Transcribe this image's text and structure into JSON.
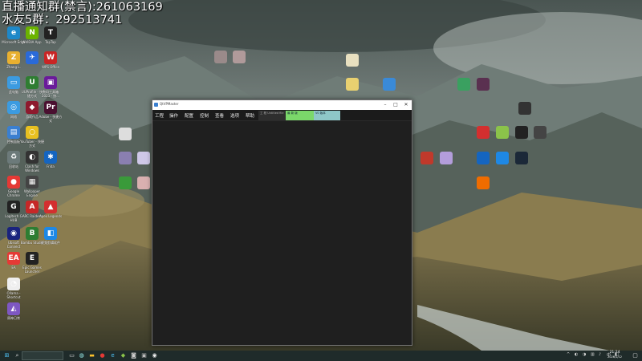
{
  "overlay": {
    "line1": "直播通知群(禁言):261063169",
    "line2": "水友5群：292513741"
  },
  "desktop_icons": [
    {
      "id": "edge",
      "label": "Microsoft Edge",
      "color": "#1e88c8",
      "glyph": "e"
    },
    {
      "id": "nvidia",
      "label": "NVIDIA App",
      "color": "#6bb300",
      "glyph": "N"
    },
    {
      "id": "taptap",
      "label": "TapTap",
      "color": "#222",
      "glyph": "T"
    },
    {
      "id": "zhang",
      "label": "Zhang L.",
      "color": "#e8b030",
      "glyph": "Z"
    },
    {
      "id": "app-blue",
      "label": "",
      "color": "#2a6ad8",
      "glyph": "✈"
    },
    {
      "id": "wps",
      "label": "WPS Office",
      "color": "#c92525",
      "glyph": "W"
    },
    {
      "id": "pc",
      "label": "此电脑",
      "color": "#3c9be0",
      "glyph": "▭"
    },
    {
      "id": "uuprofile",
      "label": "UUProfile - 快捷方式",
      "color": "#2f7d32",
      "glyph": "U"
    },
    {
      "id": "shouji",
      "label": "数码工具箱 2023 - 快...",
      "color": "#6a1b9a",
      "glyph": "▣"
    },
    {
      "id": "net",
      "label": "网络",
      "color": "#3c9be0",
      "glyph": "◎"
    },
    {
      "id": "game",
      "label": "游戏作品",
      "color": "#8e1a2e",
      "glyph": "◆"
    },
    {
      "id": "adobe",
      "label": "Adobe - 快捷方式",
      "color": "#4a1030",
      "glyph": "Pr"
    },
    {
      "id": "panel",
      "label": "控制面板",
      "color": "#3a7fd0",
      "glyph": "▤"
    },
    {
      "id": "shell",
      "label": "YouTuber - 快捷方式",
      "color": "#e8c020",
      "glyph": "○"
    },
    {
      "id": "recycle",
      "label": "回收站",
      "color": "#6c7a7a",
      "glyph": "♻"
    },
    {
      "id": "clash",
      "label": "Clash for Windows",
      "color": "#333",
      "glyph": "◐"
    },
    {
      "id": "frida",
      "label": "Frida",
      "color": "#1565c0",
      "glyph": "✱"
    },
    {
      "id": "chrome",
      "label": "Google Chrome",
      "color": "#e53935",
      "glyph": "●"
    },
    {
      "id": "wallpaper",
      "label": "Wallpaper Engine",
      "color": "#444",
      "glyph": "▦"
    },
    {
      "id": "logi",
      "label": "Logitech G HUB",
      "color": "#222",
      "glyph": "G"
    },
    {
      "id": "arc",
      "label": "ARC Raiders",
      "color": "#c62828",
      "glyph": "A"
    },
    {
      "id": "apex",
      "label": "Apex Legends",
      "color": "#d32f2f",
      "glyph": "▲"
    },
    {
      "id": "ubisoft",
      "label": "Ubisoft Connect",
      "color": "#1a237e",
      "glyph": "◉"
    },
    {
      "id": "bambu",
      "label": "Bambu Studio",
      "color": "#2e7d32",
      "glyph": "B"
    },
    {
      "id": "screen",
      "label": "视频剪辑软件",
      "color": "#1e88e5",
      "glyph": "◧"
    },
    {
      "id": "ea",
      "label": "EA",
      "color": "#e53935",
      "glyph": "EA"
    },
    {
      "id": "epic",
      "label": "Epic Games Launcher",
      "color": "#222",
      "glyph": "E"
    },
    {
      "id": "ollama",
      "label": "Ollama - Shortcut",
      "color": "#eee",
      "glyph": "◔"
    },
    {
      "id": "ganyu",
      "label": "原神日常",
      "color": "#7e57c2",
      "glyph": "◭"
    }
  ],
  "app_window": {
    "title": "QtVPMaster",
    "menu": [
      "工程",
      "操作",
      "配置",
      "控制",
      "查看",
      "选项",
      "帮助"
    ],
    "tabs": [
      "工 程 Untitled file",
      "最 新 版",
      "V0 版本"
    ]
  },
  "taskbar": {
    "time": "21:24",
    "date": "2026/1/12"
  }
}
